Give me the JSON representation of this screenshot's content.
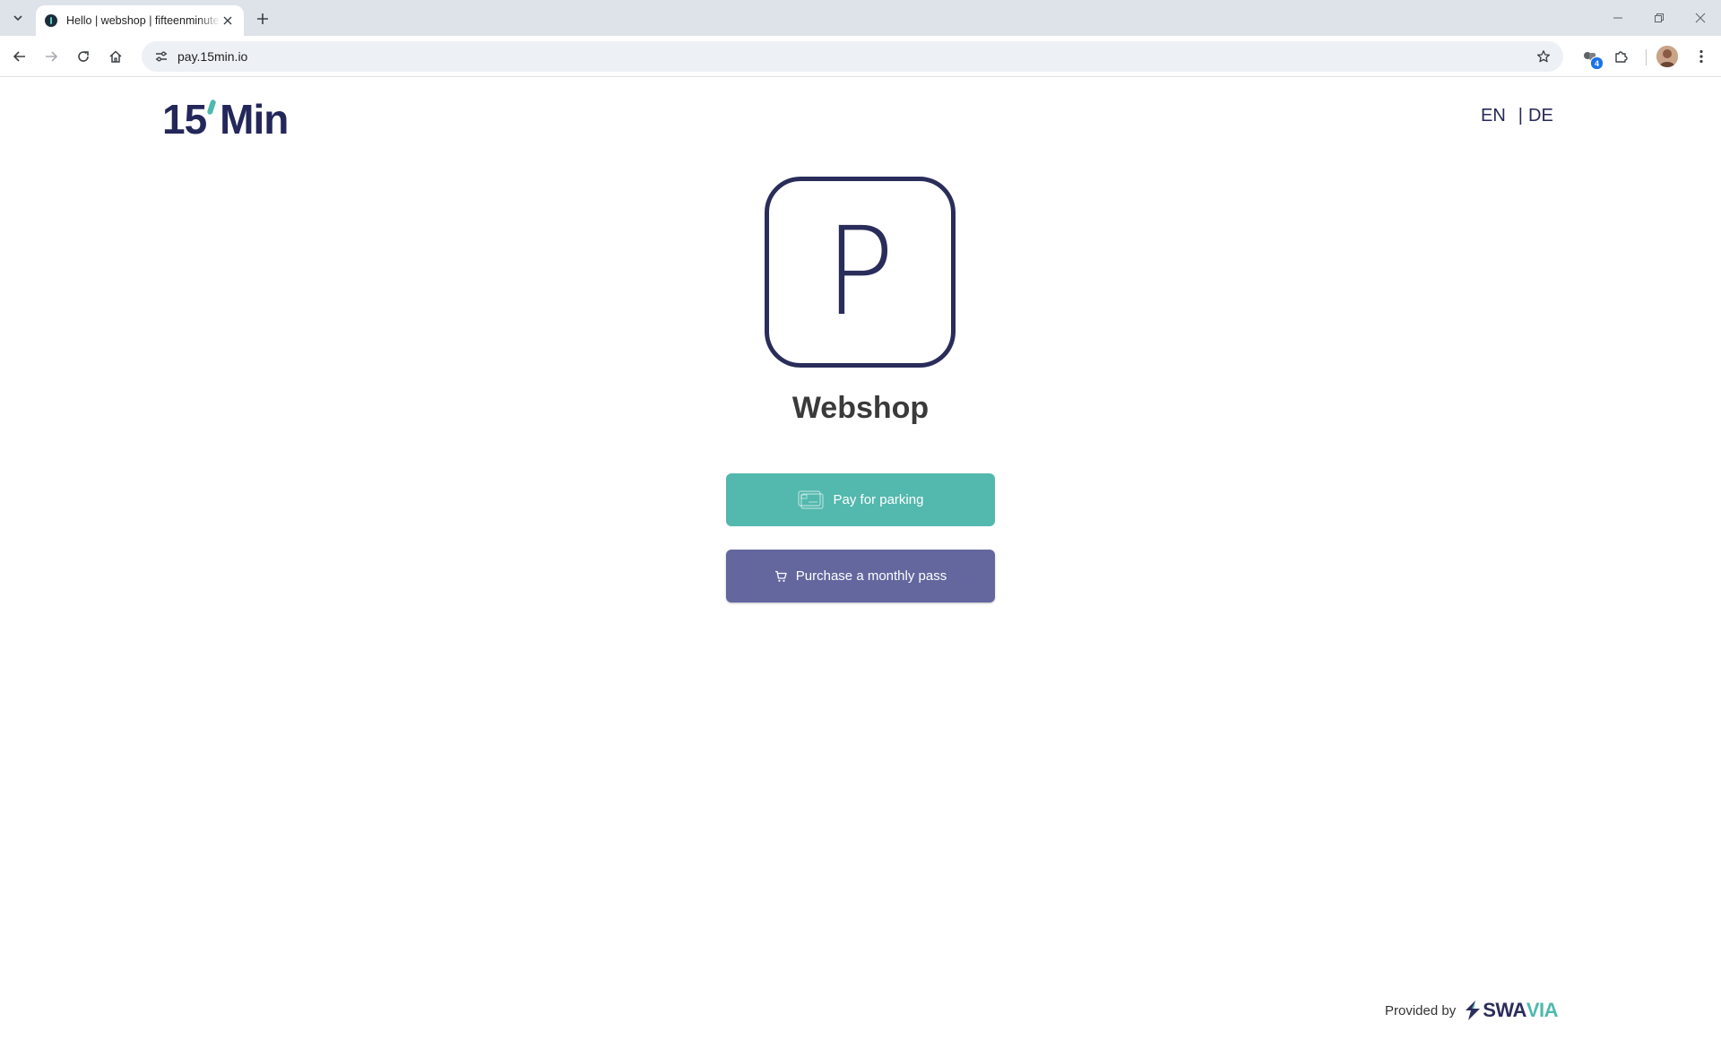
{
  "browser": {
    "tab_title": "Hello | webshop | fifteenminutes",
    "url": "pay.15min.io",
    "extension_badge": "4"
  },
  "header": {
    "logo_text_left": "15",
    "logo_text_right": "Min",
    "lang_en": "EN",
    "lang_separator": "|",
    "lang_de": "DE"
  },
  "main": {
    "icon_letter": "P",
    "title": "Webshop",
    "pay_parking_label": "Pay for parking",
    "monthly_pass_label": "Purchase a monthly pass"
  },
  "footer": {
    "provided_by": "Provided by",
    "brand_a": "SWA",
    "brand_b": "VIA"
  },
  "colors": {
    "teal": "#53b8ae",
    "purple": "#63679e",
    "navy": "#2a2c5a"
  }
}
